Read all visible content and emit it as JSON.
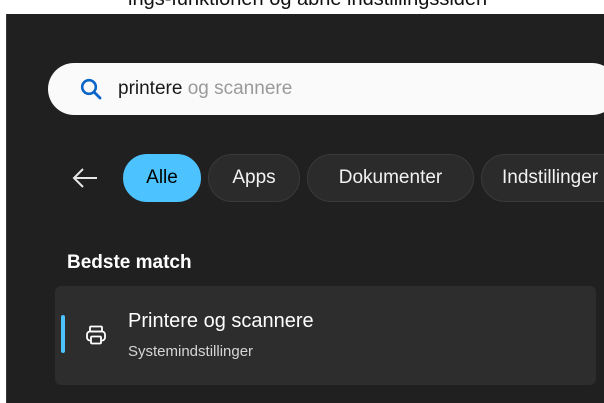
{
  "top_caption": "ings-funktionen og åbne indstillingssiden",
  "search": {
    "typed": "printere",
    "suggestion": " og scannere"
  },
  "filters": {
    "back_label": "←",
    "chips": [
      {
        "label": "Alle",
        "active": true
      },
      {
        "label": "Apps",
        "active": false
      },
      {
        "label": "Dokumenter",
        "active": false
      },
      {
        "label": "Indstillinger",
        "active": false
      }
    ]
  },
  "best_match": {
    "heading": "Bedste match",
    "title": "Printere og scannere",
    "subtitle": "Systemindstillinger",
    "icon": "printer-icon"
  },
  "colors": {
    "panel": "#202020",
    "accent": "#4cc2ff",
    "card": "#2d2d2d"
  }
}
